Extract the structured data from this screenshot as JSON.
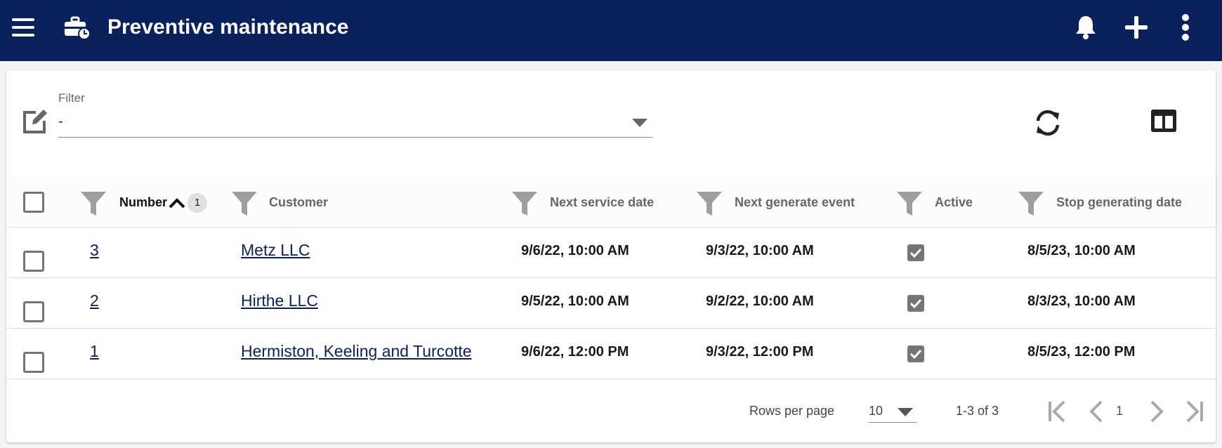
{
  "appbar": {
    "title": "Preventive maintenance",
    "background": "#0b215c",
    "icons": [
      "menu-icon",
      "toolbox-clock-icon",
      "bell-icon",
      "plus-icon",
      "more-vertical-icon"
    ]
  },
  "filter": {
    "label": "Filter",
    "value": "-"
  },
  "toolbar": {
    "icons": [
      "edit-icon",
      "refresh-icon",
      "columns-icon"
    ]
  },
  "table": {
    "columns": [
      {
        "label": "Number",
        "sorted": "ascending",
        "sort_badge": "1"
      },
      {
        "label": "Customer"
      },
      {
        "label": "Next service date"
      },
      {
        "label": "Next generate event"
      },
      {
        "label": "Active"
      },
      {
        "label": "Stop generating date"
      }
    ],
    "rows": [
      {
        "number": "3",
        "customer": "Metz LLC",
        "next_service_date": "9/6/22, 10:00 AM",
        "next_generate_event": "9/3/22, 10:00 AM",
        "active": true,
        "stop_generating_date": "8/5/23, 10:00 AM"
      },
      {
        "number": "2",
        "customer": "Hirthe LLC",
        "next_service_date": "9/5/22, 10:00 AM",
        "next_generate_event": "9/2/22, 10:00 AM",
        "active": true,
        "stop_generating_date": "8/3/23, 10:00 AM"
      },
      {
        "number": "1",
        "customer": "Hermiston, Keeling and Turcotte",
        "next_service_date": "9/6/22, 12:00 PM",
        "next_generate_event": "9/3/22, 12:00 PM",
        "active": true,
        "stop_generating_date": "8/5/23, 12:00 PM"
      }
    ]
  },
  "pagination": {
    "rows_per_page_label": "Rows per page",
    "rows_per_page_value": "10",
    "range": "1-3 of 3",
    "page": "1"
  }
}
